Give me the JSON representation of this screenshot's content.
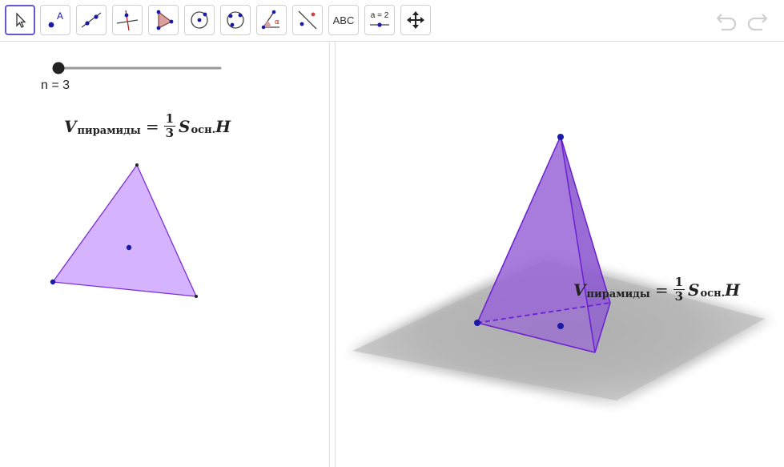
{
  "toolbar": {
    "tools": [
      {
        "name": "move-tool",
        "icon": "arrow-cursor-icon",
        "active": true
      },
      {
        "name": "point-tool",
        "icon": "point-icon",
        "label": "A"
      },
      {
        "name": "line-tool",
        "icon": "line-through-points-icon"
      },
      {
        "name": "perpendicular-line-tool",
        "icon": "perpendicular-line-icon"
      },
      {
        "name": "polygon-tool",
        "icon": "polygon-icon"
      },
      {
        "name": "circle-tool",
        "icon": "circle-center-point-icon"
      },
      {
        "name": "circle-three-points-tool",
        "icon": "circle-three-points-icon"
      },
      {
        "name": "angle-tool",
        "icon": "angle-icon",
        "label": "α"
      },
      {
        "name": "reflect-tool",
        "icon": "reflect-about-line-icon"
      },
      {
        "name": "text-tool",
        "icon": "text-icon",
        "label": "ABC"
      },
      {
        "name": "slider-tool",
        "icon": "slider-icon",
        "label": "a = 2"
      },
      {
        "name": "move-graphics-view-tool",
        "icon": "move-arrows-icon"
      }
    ],
    "undo_icon": "undo-icon",
    "redo_icon": "redo-icon"
  },
  "algebra": {
    "slider": {
      "label": "n = 3",
      "value": 3
    }
  },
  "formula": {
    "V": "V",
    "V_sub": "пирамиды",
    "eq": "=",
    "frac_num": "1",
    "frac_den": "3",
    "S": "S",
    "S_sub": "осн.",
    "H": "H"
  },
  "colors": {
    "accent": "#6557d2",
    "polygon_fill": "#d6b3ff",
    "polygon_stroke": "#7b2fd8",
    "pyramid_face": "#9966d6",
    "point": "#1a1aa6"
  }
}
